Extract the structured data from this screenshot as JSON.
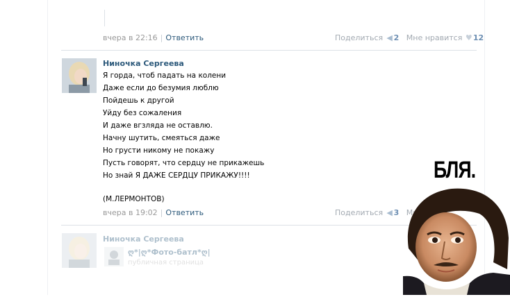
{
  "top_comment": {
    "time": "вчера в 22:16",
    "reply": "Ответить",
    "share_label": "Поделиться",
    "share_count": "2",
    "like_label": "Мне нравится",
    "like_count": "12"
  },
  "main_comment": {
    "author": "Ниночка Сергеева",
    "lines": [
      "Я горда, чтоб падать на колени",
      "Даже если до безумия люблю",
      "Пойдешь к другой",
      "Уйду без сожаления",
      "И даже вгзляда не оставлю.",
      "Начну шутить, смеяться даже",
      "Но грусти никому не покажу",
      "Пусть говорят, что сердцу не прикажешь",
      "Но знай Я ДАЖЕ СЕРДЦУ ПРИКАЖУ!!!!",
      "(М.ЛЕРМОНТОВ)"
    ],
    "time": "вчера в 19:02",
    "reply": "Ответить",
    "share_label": "Поделиться",
    "share_count": "3",
    "like_label_partial": "Мн"
  },
  "next_comment": {
    "author": "Ниночка Сергеева",
    "group_name": "ღ*|ღ*Фото-батл*ღ|",
    "group_sub": "публичная страница"
  },
  "overlay": {
    "caption": "БЛЯ."
  },
  "colors": {
    "link": "#2b587a",
    "meta": "#999999",
    "divider": "#dce1e6"
  }
}
